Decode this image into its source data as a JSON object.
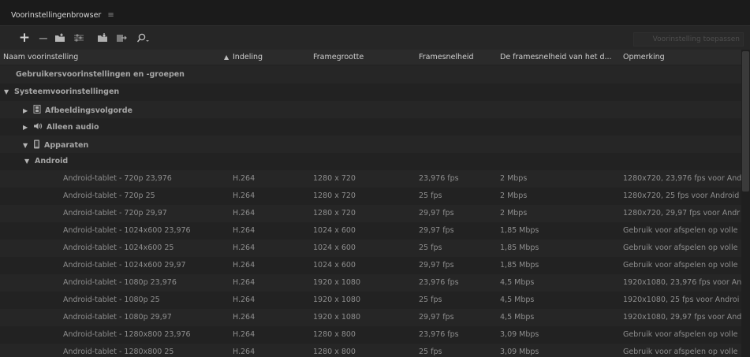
{
  "tab": {
    "title": "Voorinstellingenbrowser",
    "menu_icon": "≡"
  },
  "toolbar": {
    "add_icon": "+",
    "remove_icon": "−",
    "apply_label": "Voorinstelling toepassen"
  },
  "columns": [
    "Naam voorinstelling",
    "Indeling",
    "Framegrootte",
    "Framesnelheid",
    "De framesnelheid van het d...",
    "Opmerking"
  ],
  "groups": {
    "user": "Gebruikersvoorinstellingen en -groepen",
    "system": "Systeemvoorinstellingen",
    "image_sequence": "Afbeeldingsvolgorde",
    "audio_only": "Alleen audio",
    "devices": "Apparaten",
    "android": "Android"
  },
  "presets": [
    {
      "name": "Android-tablet - 720p 23,976",
      "format": "H.264",
      "size": "1280 x 720",
      "rate": "23,976 fps",
      "bitrate": "2 Mbps",
      "comment": "1280x720, 23,976 fps voor And"
    },
    {
      "name": "Android-tablet - 720p 25",
      "format": "H.264",
      "size": "1280 x 720",
      "rate": "25 fps",
      "bitrate": "2 Mbps",
      "comment": "1280x720, 25 fps voor Android"
    },
    {
      "name": "Android-tablet - 720p 29,97",
      "format": "H.264",
      "size": "1280 x 720",
      "rate": "29,97 fps",
      "bitrate": "2 Mbps",
      "comment": "1280x720, 29,97 fps voor Andr"
    },
    {
      "name": "Android-tablet - 1024x600 23,976",
      "format": "H.264",
      "size": "1024 x 600",
      "rate": "29,97 fps",
      "bitrate": "1,85 Mbps",
      "comment": "Gebruik voor afspelen op volle"
    },
    {
      "name": "Android-tablet - 1024x600 25",
      "format": "H.264",
      "size": "1024 x 600",
      "rate": "25 fps",
      "bitrate": "1,85 Mbps",
      "comment": "Gebruik voor afspelen op volle"
    },
    {
      "name": "Android-tablet - 1024x600 29,97",
      "format": "H.264",
      "size": "1024 x 600",
      "rate": "29,97 fps",
      "bitrate": "1,85 Mbps",
      "comment": "Gebruik voor afspelen op volle"
    },
    {
      "name": "Android-tablet - 1080p 23,976",
      "format": "H.264",
      "size": "1920 x 1080",
      "rate": "23,976 fps",
      "bitrate": "4,5 Mbps",
      "comment": "1920x1080, 23,976 fps voor An"
    },
    {
      "name": "Android-tablet - 1080p 25",
      "format": "H.264",
      "size": "1920 x 1080",
      "rate": "25 fps",
      "bitrate": "4,5 Mbps",
      "comment": "1920x1080, 25 fps voor Androi"
    },
    {
      "name": "Android-tablet - 1080p 29,97",
      "format": "H.264",
      "size": "1920 x 1080",
      "rate": "29,97 fps",
      "bitrate": "4,5 Mbps",
      "comment": "1920x1080, 29,97 fps voor And"
    },
    {
      "name": "Android-tablet - 1280x800 23,976",
      "format": "H.264",
      "size": "1280 x 800",
      "rate": "23,976 fps",
      "bitrate": "3,09 Mbps",
      "comment": "Gebruik voor afspelen op volle"
    },
    {
      "name": "Android-tablet - 1280x800 25",
      "format": "H.264",
      "size": "1280 x 800",
      "rate": "25 fps",
      "bitrate": "3,09 Mbps",
      "comment": "Gebruik voor afspelen op volle"
    }
  ]
}
